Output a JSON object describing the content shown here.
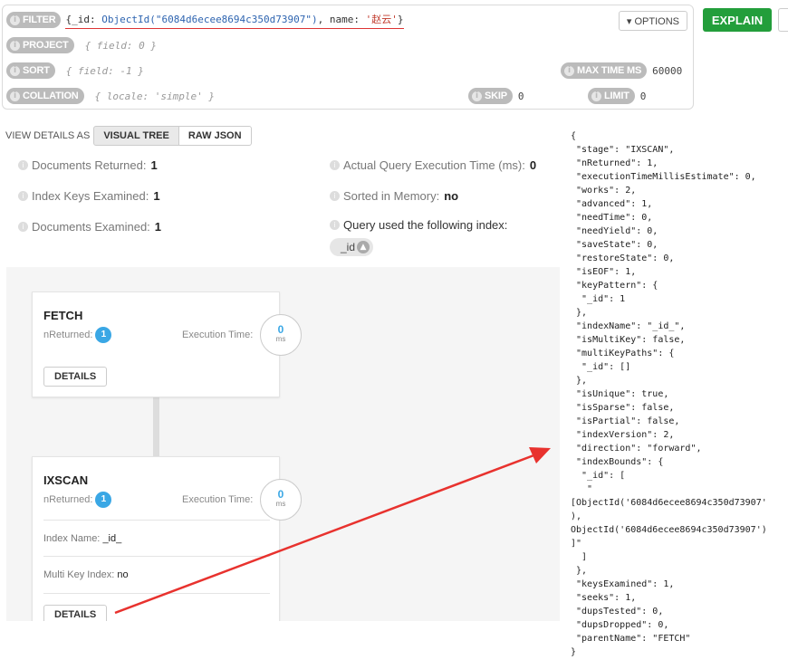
{
  "query_bar": {
    "filter_label": "FILTER",
    "filter_prefix": "{_id: ",
    "filter_objectid": "ObjectId(\"6084d6ecee8694c350d73907\")",
    "filter_mid": ", name: ",
    "filter_name": "'赵云'",
    "filter_suffix": "}",
    "options_label": "▾ OPTIONS",
    "project_label": "PROJECT",
    "project_placeholder": "{ field: 0 }",
    "sort_label": "SORT",
    "sort_placeholder": "{ field: -1 }",
    "max_time_label": "MAX TIME MS",
    "max_time_value": "60000",
    "collation_label": "COLLATION",
    "collation_placeholder": "{ locale: 'simple' }",
    "skip_label": "SKIP",
    "skip_value": "0",
    "limit_label": "LIMIT",
    "limit_value": "0",
    "explain_label": "EXPLAIN"
  },
  "view_details": {
    "label": "VIEW DETAILS AS",
    "visual_tree": "VISUAL TREE",
    "raw_json": "RAW JSON"
  },
  "summary": {
    "docs_returned_label": "Documents Returned:",
    "docs_returned": "1",
    "keys_examined_label": "Index Keys Examined:",
    "keys_examined": "1",
    "docs_examined_label": "Documents Examined:",
    "docs_examined": "1",
    "exec_time_label": "Actual Query Execution Time (ms):",
    "exec_time": "0",
    "sorted_label": "Sorted in Memory:",
    "sorted": "no",
    "index_used_label": "Query used the following index:",
    "index_name": "_id"
  },
  "stages": {
    "fetch": {
      "title": "FETCH",
      "nreturned_label": "nReturned:",
      "nreturned": "1",
      "exec_label": "Execution Time:",
      "exec_value": "0",
      "exec_unit": "ms",
      "details_label": "DETAILS"
    },
    "ixscan": {
      "title": "IXSCAN",
      "nreturned_label": "nReturned:",
      "nreturned": "1",
      "exec_label": "Execution Time:",
      "exec_value": "0",
      "exec_unit": "ms",
      "index_name_label": "Index Name:",
      "index_name": "_id_",
      "multikey_label": "Multi Key Index:",
      "multikey": "no",
      "details_label": "DETAILS"
    }
  },
  "raw_json_text": "{\n \"stage\": \"IXSCAN\",\n \"nReturned\": 1,\n \"executionTimeMillisEstimate\": 0,\n \"works\": 2,\n \"advanced\": 1,\n \"needTime\": 0,\n \"needYield\": 0,\n \"saveState\": 0,\n \"restoreState\": 0,\n \"isEOF\": 1,\n \"keyPattern\": {\n  \"_id\": 1\n },\n \"indexName\": \"_id_\",\n \"isMultiKey\": false,\n \"multiKeyPaths\": {\n  \"_id\": []\n },\n \"isUnique\": true,\n \"isSparse\": false,\n \"isPartial\": false,\n \"indexVersion\": 2,\n \"direction\": \"forward\",\n \"indexBounds\": {\n  \"_id\": [\n   \"\n[ObjectId('6084d6ecee8694c350d73907'\n),\nObjectId('6084d6ecee8694c350d73907')\n]\"\n  ]\n },\n \"keysExamined\": 1,\n \"seeks\": 1,\n \"dupsTested\": 0,\n \"dupsDropped\": 0,\n \"parentName\": \"FETCH\"\n}",
  "colors": {
    "explain_green": "#239e3b",
    "badge_blue": "#3aa7e5",
    "annotation_red": "#e8322e"
  }
}
